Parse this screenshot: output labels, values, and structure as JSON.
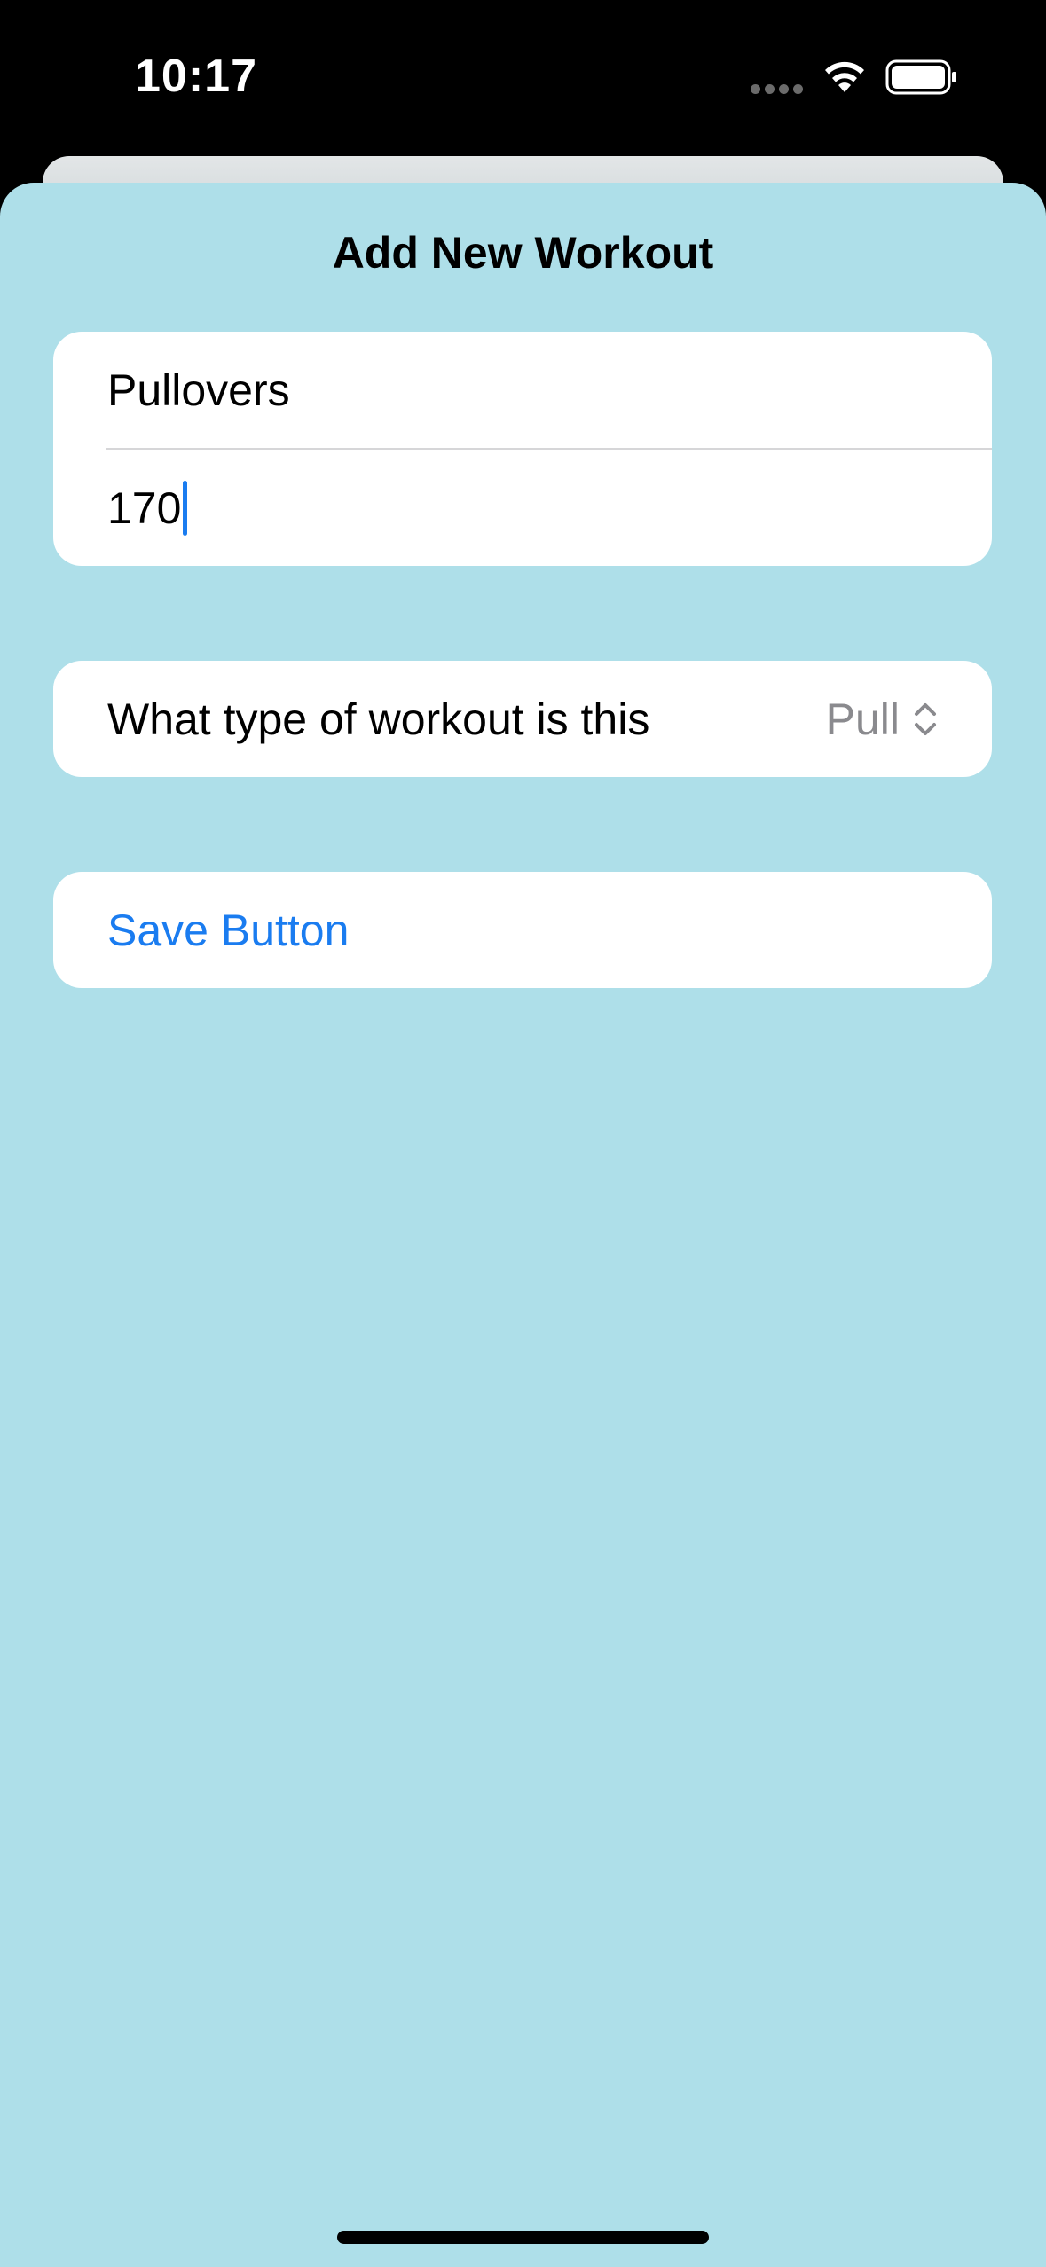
{
  "status_bar": {
    "time": "10:17",
    "icons": [
      "signal-dots-icon",
      "wifi-icon",
      "battery-icon"
    ]
  },
  "sheet": {
    "title": "Add New Workout",
    "background_color": "#aedfe9"
  },
  "form": {
    "name_field_value": "Pullovers",
    "weight_field_value": "170",
    "picker_label": "What type of workout is this",
    "picker_value": "Pull",
    "save_label": "Save Button"
  },
  "colors": {
    "accent": "#1a7cf0",
    "secondary_text": "#8a8a8e"
  }
}
